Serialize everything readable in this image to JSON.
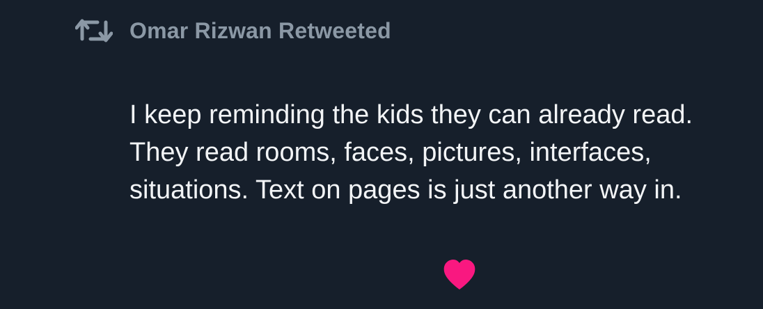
{
  "tweet": {
    "retweet_context": {
      "icon": "retweet-icon",
      "label": "Omar Rizwan Retweeted"
    },
    "text": "I keep reminding the kids they can already read. They read rooms, faces, pictures, interfaces, situations. Text on pages is just another way in.",
    "like": {
      "icon": "heart-icon",
      "liked": true,
      "color": "#f91880"
    }
  },
  "colors": {
    "background": "#161f2b",
    "muted": "#8b98a5",
    "text": "#f2f4f6",
    "like": "#f91880"
  }
}
